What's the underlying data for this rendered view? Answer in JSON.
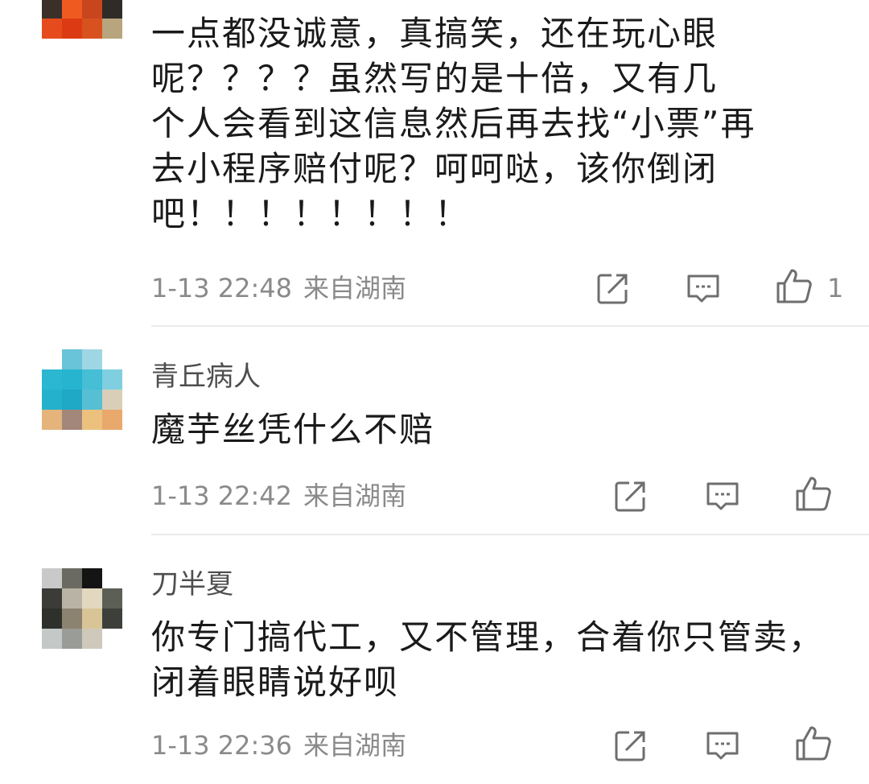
{
  "comments": [
    {
      "username": "",
      "text_lines": [
        "一点都没诚意，真搞笑，还在玩心眼",
        "呢？？？？虽然写的是十倍，又有几",
        "个人会看到这信息然后再去找“小票”再",
        "去小程序赔付呢？呵呵哒，该你倒闭",
        "吧！！！！！！！！"
      ],
      "time": "1-13 22:48",
      "location": "来自湖南",
      "like_count": "1",
      "avatar_colors": [
        "#23262b",
        "#2b2d30",
        "#4a3b33",
        "#1b1e22",
        "#3b2f2a",
        "#ef5a21",
        "#c9451e",
        "#2f2b26",
        "#e54b1d",
        "#dc3a12",
        "#d8521f",
        "#b8a57e",
        "#ffffff",
        "#ffffff",
        "#ffffff",
        "#ffffff"
      ]
    },
    {
      "username": "青丘病人",
      "text_lines": [
        "魔芋丝凭什么不赔"
      ],
      "time": "1-13 22:42",
      "location": "来自湖南",
      "like_count": "",
      "avatar_colors": [
        "#ffffff",
        "#69c3d9",
        "#9fd6e4",
        "#ffffff",
        "#2bb7d1",
        "#26b4cf",
        "#45bed6",
        "#7fcfe0",
        "#23b1cc",
        "#1fa9c6",
        "#56bfd4",
        "#d9cfb9",
        "#e4b47b",
        "#a3877a",
        "#ecc17e",
        "#e9a96c"
      ]
    },
    {
      "username": "刀半夏",
      "text_lines": [
        "你专门搞代工，又不管理，合着你只管卖，",
        "闭着眼睛说好呗"
      ],
      "time": "1-13 22:36",
      "location": "来自湖南",
      "like_count": "",
      "avatar_colors": [
        "#c9c9c9",
        "#6a6a62",
        "#141414",
        "#ffffff",
        "#3b3b38",
        "#b9b3a6",
        "#e2d8bf",
        "#5c5f55",
        "#2e302c",
        "#8b8270",
        "#d9c497",
        "#3d3f3a",
        "#c4c8c7",
        "#9a9c98",
        "#cfc9bb",
        "#ffffff"
      ]
    }
  ]
}
